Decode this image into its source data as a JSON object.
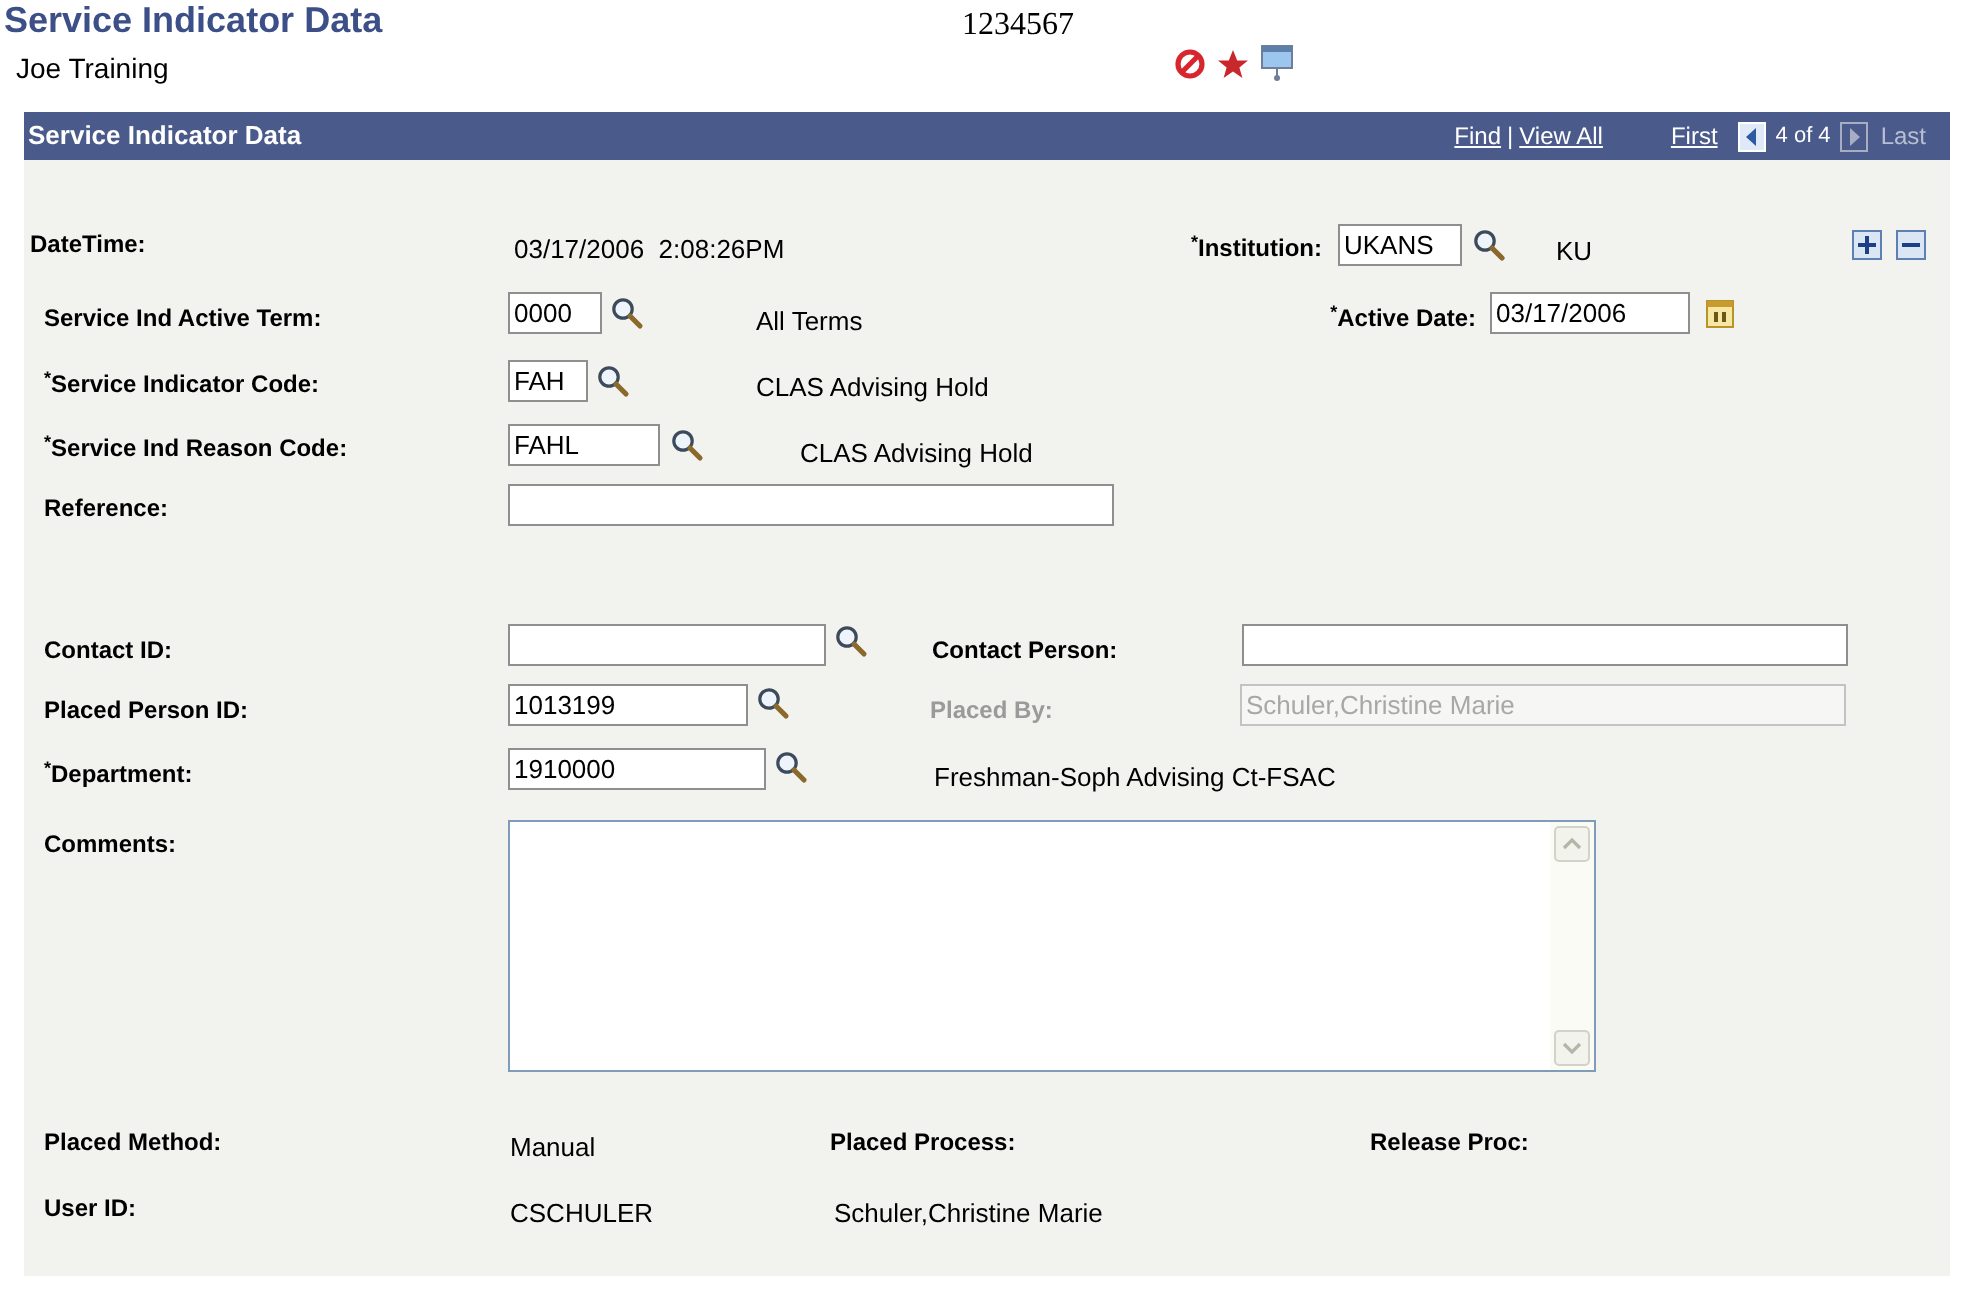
{
  "page_title": "Service Indicator Data",
  "person_name": "Joe Training",
  "person_id": "1234567",
  "panel": {
    "title": "Service Indicator Data",
    "find": "Find",
    "separator": "|",
    "view_all": "View All",
    "first": "First",
    "position": "4 of 4",
    "last": "Last",
    "prev_disabled": false,
    "next_disabled": true
  },
  "datetime": {
    "label": "DateTime:",
    "value": "03/17/2006  2:08:26PM"
  },
  "institution": {
    "label": "$^{*}$Institution:",
    "value": "UKANS",
    "description": "KU"
  },
  "active_term": {
    "label": "Service Ind Active Term:",
    "value": "0000",
    "description": "All Terms"
  },
  "active_date": {
    "label": "$^{*}$Active Date:",
    "value": "03/17/2006"
  },
  "indicator_code": {
    "label": "$^{*}$Service Indicator Code:",
    "value": "FAH",
    "description": "CLAS Advising Hold"
  },
  "reason_code": {
    "label": "$^{*}$Service Ind Reason Code:",
    "value": "FAHL",
    "description": "CLAS Advising Hold"
  },
  "reference": {
    "label": "Reference:"
  },
  "contact_id": {
    "label": "Contact ID:"
  },
  "contact_person": {
    "label": "Contact Person:"
  },
  "placed_person_id": {
    "label": "Placed Person ID:",
    "value": "1013199"
  },
  "placed_by": {
    "label": "Placed By:",
    "value": "Schuler,Christine Marie",
    "disabled": true
  },
  "department": {
    "label": "$^{*}$Department:",
    "value": "1910000",
    "description": "Freshman-Soph Advising Ct-FSAC"
  },
  "comments": {
    "label": "Comments:"
  },
  "placed_method": {
    "label": "Placed Method:",
    "value": "Manual"
  },
  "placed_process": {
    "label": "Placed Process:"
  },
  "release_proc": {
    "label": "Release Proc:"
  },
  "user_id": {
    "label": "User ID:",
    "value": "CSCHULER",
    "name": "Schuler,Christine Marie"
  }
}
